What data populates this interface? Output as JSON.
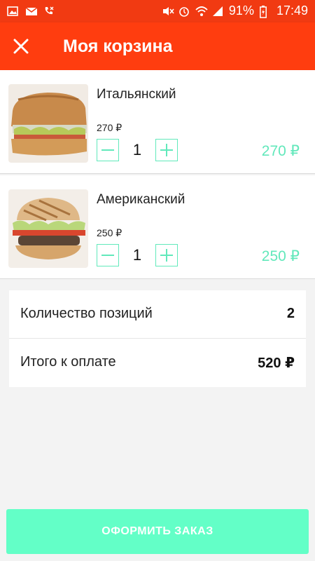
{
  "status_bar": {
    "battery": "91%",
    "time": "17:49",
    "icons": [
      "gallery-icon",
      "mail-icon",
      "missed-call-icon",
      "mute-icon",
      "alarm-icon",
      "wifi-icon",
      "signal-icon",
      "battery-icon"
    ]
  },
  "header": {
    "title": "Моя корзина",
    "close_icon": "close-icon"
  },
  "cart": {
    "items": [
      {
        "name": "Итальянский",
        "unit_price": "270 ₽",
        "quantity": "1",
        "total": "270 ₽"
      },
      {
        "name": "Американский",
        "unit_price": "250 ₽",
        "quantity": "1",
        "total": "250 ₽"
      }
    ]
  },
  "summary": {
    "count_label": "Количество позиций",
    "count_value": "2",
    "total_label": "Итого к оплате",
    "total_value": "520 ₽"
  },
  "checkout": {
    "label": "ОФОРМИТЬ ЗАКАЗ"
  },
  "colors": {
    "header": "#ff3d0f",
    "accent": "#62e8bb",
    "checkout": "#63ffc7"
  }
}
